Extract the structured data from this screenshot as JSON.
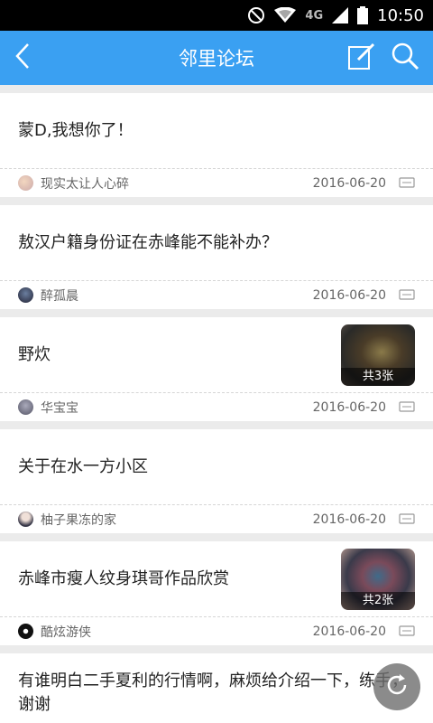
{
  "status": {
    "network": "4G",
    "time": "10:50"
  },
  "appbar": {
    "title": "邻里论坛"
  },
  "posts": [
    {
      "title": "蒙D,我想你了！",
      "author": "现实太让人心碎",
      "date": "2016-06-20"
    },
    {
      "title": "敖汉户籍身份证在赤峰能不能补办？",
      "author": "醉孤晨",
      "date": "2016-06-20"
    },
    {
      "title": "野炊",
      "author": "华宝宝",
      "date": "2016-06-20",
      "thumb_caption": "共3张"
    },
    {
      "title": "关于在水一方小区",
      "author": "柚子果冻的家",
      "date": "2016-06-20"
    },
    {
      "title": "赤峰市瘦人纹身琪哥作品欣赏",
      "author": "酷炫游侠",
      "date": "2016-06-20",
      "thumb_caption": "共2张"
    },
    {
      "title": "有谁明白二手夏利的行情啊，麻烦给介绍一下，练手，谢谢"
    }
  ],
  "colors": {
    "appbar": "#3aa0f2",
    "background": "#ebebeb"
  }
}
